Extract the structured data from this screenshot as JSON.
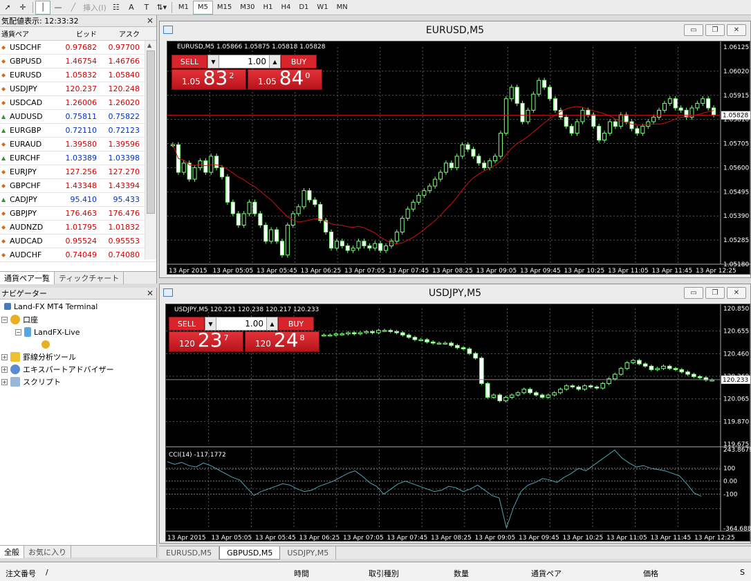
{
  "toolbar": {
    "insert_label": "挿入(I)",
    "timeframes": [
      "M1",
      "M5",
      "M15",
      "M30",
      "H1",
      "H4",
      "D1",
      "W1",
      "MN"
    ]
  },
  "market_watch": {
    "title": "気配値表示: 12:33:32",
    "col_symbol": "通貨ペア",
    "col_bid": "ビッド",
    "col_ask": "アスク",
    "rows": [
      {
        "symbol": "USDCHF",
        "bid": "0.97682",
        "ask": "0.97700",
        "color": "red",
        "dir": "down"
      },
      {
        "symbol": "GBPUSD",
        "bid": "1.46754",
        "ask": "1.46766",
        "color": "red",
        "dir": "down"
      },
      {
        "symbol": "EURUSD",
        "bid": "1.05832",
        "ask": "1.05840",
        "color": "red",
        "dir": "down"
      },
      {
        "symbol": "USDJPY",
        "bid": "120.237",
        "ask": "120.248",
        "color": "red",
        "dir": "down"
      },
      {
        "symbol": "USDCAD",
        "bid": "1.26006",
        "ask": "1.26020",
        "color": "red",
        "dir": "down"
      },
      {
        "symbol": "AUDUSD",
        "bid": "0.75811",
        "ask": "0.75822",
        "color": "blue",
        "dir": "up"
      },
      {
        "symbol": "EURGBP",
        "bid": "0.72110",
        "ask": "0.72123",
        "color": "blue",
        "dir": "up"
      },
      {
        "symbol": "EURAUD",
        "bid": "1.39580",
        "ask": "1.39596",
        "color": "red",
        "dir": "down"
      },
      {
        "symbol": "EURCHF",
        "bid": "1.03389",
        "ask": "1.03398",
        "color": "blue",
        "dir": "up"
      },
      {
        "symbol": "EURJPY",
        "bid": "127.256",
        "ask": "127.270",
        "color": "red",
        "dir": "down"
      },
      {
        "symbol": "GBPCHF",
        "bid": "1.43348",
        "ask": "1.43394",
        "color": "red",
        "dir": "down"
      },
      {
        "symbol": "CADJPY",
        "bid": "95.410",
        "ask": "95.433",
        "color": "blue",
        "dir": "up"
      },
      {
        "symbol": "GBPJPY",
        "bid": "176.463",
        "ask": "176.476",
        "color": "red",
        "dir": "down"
      },
      {
        "symbol": "AUDNZD",
        "bid": "1.01795",
        "ask": "1.01832",
        "color": "red",
        "dir": "down"
      },
      {
        "symbol": "AUDCAD",
        "bid": "0.95524",
        "ask": "0.95553",
        "color": "red",
        "dir": "down"
      },
      {
        "symbol": "AUDCHF",
        "bid": "0.74049",
        "ask": "0.74080",
        "color": "red",
        "dir": "down"
      }
    ],
    "tab_symbols": "通貨ペア一覧",
    "tab_tick": "ティックチャート"
  },
  "navigator": {
    "title": "ナビゲーター",
    "root": "Land-FX MT4 Terminal",
    "accounts": "口座",
    "account_live": "LandFX-Live",
    "indicators": "罫線分析ツール",
    "experts": "エキスパートアドバイザー",
    "scripts": "スクリプト",
    "tab_general": "全般",
    "tab_favorites": "お気に入り"
  },
  "chart_eurusd": {
    "window_title": "EURUSD,M5",
    "info_line": "EURUSD,M5  1.05866 1.05875 1.05818 1.05828",
    "sell_label": "SELL",
    "buy_label": "BUY",
    "lot": "1.00",
    "sell_prefix": "1.05",
    "sell_big": "83",
    "sell_sup": "2",
    "buy_prefix": "1.05",
    "buy_big": "84",
    "buy_sup": "0",
    "price_marker": "1.05828",
    "price_axis": [
      "1.06125",
      "1.06020",
      "1.05915",
      "1.05810",
      "1.05705",
      "1.05600",
      "1.05495",
      "1.05390",
      "1.05285",
      "1.05180"
    ],
    "time_axis": [
      "13 Apr 2015",
      "13 Apr 05:05",
      "13 Apr 05:45",
      "13 Apr 06:25",
      "13 Apr 07:05",
      "13 Apr 07:45",
      "13 Apr 08:25",
      "13 Apr 09:05",
      "13 Apr 09:45",
      "13 Apr 10:25",
      "13 Apr 11:05",
      "13 Apr 11:45",
      "13 Apr 12:25"
    ]
  },
  "chart_usdjpy": {
    "window_title": "USDJPY,M5",
    "info_line": "USDJPY,M5  120.221 120.238 120.217 120.233",
    "sell_label": "SELL",
    "buy_label": "BUY",
    "lot": "1.00",
    "sell_prefix": "120",
    "sell_big": "23",
    "sell_sup": "7",
    "buy_prefix": "120",
    "buy_big": "24",
    "buy_sup": "8",
    "price_marker": "120.233",
    "price_axis": [
      "120.850",
      "120.655",
      "120.460",
      "120.260",
      "120.065",
      "119.870",
      "119.675"
    ],
    "cci_label": "CCI(14) -117.1772",
    "cci_axis": [
      "243.8679",
      "100",
      "0.00",
      "-100",
      "-364.6885"
    ],
    "time_axis": [
      "13 Apr 2015",
      "13 Apr 05:05",
      "13 Apr 05:45",
      "13 Apr 06:25",
      "13 Apr 07:05",
      "13 Apr 07:45",
      "13 Apr 08:25",
      "13 Apr 09:05",
      "13 Apr 09:45",
      "13 Apr 10:25",
      "13 Apr 11:05",
      "13 Apr 11:45",
      "13 Apr 12:25"
    ]
  },
  "doc_tabs": [
    "EURUSD,M5",
    "GBPUSD,M5",
    "USDJPY,M5"
  ],
  "terminal": {
    "col_order": "注文番号",
    "col_time": "時間",
    "col_type": "取引種別",
    "col_qty": "数量",
    "col_symbol": "通貨ペア",
    "col_price": "価格",
    "col_s": "S"
  },
  "colors": {
    "bull": "#7dff7d",
    "bear": "#ffffff",
    "ma": "#d01010",
    "cci": "#4aa8b8",
    "grid": "#5a5a5a"
  },
  "chart_data": [
    {
      "type": "candlestick",
      "title": "EURUSD,M5",
      "closes": [
        1.057,
        1.0558,
        1.0562,
        1.0555,
        1.056,
        1.0563,
        1.0558,
        1.0565,
        1.056,
        1.0556,
        1.0545,
        1.054,
        1.0535,
        1.054,
        1.0545,
        1.054,
        1.0535,
        1.0528,
        1.0533,
        1.0528,
        1.0522,
        1.0535,
        1.054,
        1.0543,
        1.055,
        1.0546,
        1.0544,
        1.0537,
        1.0532,
        1.0525,
        1.0528,
        1.0526,
        1.0524,
        1.0525,
        1.0528,
        1.0526,
        1.0525,
        1.0527,
        1.0524,
        1.0526,
        1.0528,
        1.0532,
        1.0538,
        1.0542,
        1.0545,
        1.0548,
        1.055,
        1.0552,
        1.0555,
        1.0558,
        1.0562,
        1.056,
        1.0565,
        1.057,
        1.0568,
        1.0565,
        1.0562,
        1.056,
        1.0563,
        1.0565,
        1.0575,
        1.059,
        1.0595,
        1.0588,
        1.058,
        1.0585,
        1.0592,
        1.0598,
        1.0595,
        1.059,
        1.0585,
        1.0582,
        1.0578,
        1.0575,
        1.058,
        1.0585,
        1.0583,
        1.0578,
        1.0572,
        1.0575,
        1.058,
        1.0578,
        1.0583,
        1.058,
        1.0577,
        1.0575,
        1.0578,
        1.058,
        1.0582,
        1.0585,
        1.0588,
        1.059,
        1.0586,
        1.0585,
        1.0582,
        1.0586,
        1.0588,
        1.059,
        1.0586,
        1.0583
      ],
      "ylim": [
        1.0518,
        1.06125
      ]
    },
    {
      "type": "candlestick",
      "title": "USDJPY,M5",
      "closes": [
        120.62,
        120.62,
        120.63,
        120.63,
        120.64,
        120.63,
        120.64,
        120.65,
        120.64,
        120.66,
        120.66,
        120.65,
        120.64,
        120.62,
        120.6,
        120.58,
        120.58,
        120.56,
        120.55,
        120.55,
        120.55,
        120.53,
        120.51,
        120.5,
        120.46,
        120.42,
        120.2,
        120.08,
        120.1,
        120.05,
        120.08,
        120.1,
        120.12,
        120.15,
        120.12,
        120.1,
        120.08,
        120.1,
        120.12,
        120.15,
        120.18,
        120.17,
        120.15,
        120.18,
        120.17,
        120.16,
        120.2,
        120.24,
        120.28,
        120.33,
        120.38,
        120.4,
        120.37,
        120.35,
        120.32,
        120.33,
        120.35,
        120.33,
        120.32,
        120.3,
        120.28,
        120.26,
        120.25,
        120.23,
        120.23
      ],
      "ylim": [
        119.675,
        120.85
      ]
    },
    {
      "type": "line",
      "title": "CCI(14) -117.1772",
      "values": [
        150,
        130,
        145,
        120,
        110,
        140,
        120,
        90,
        60,
        30,
        10,
        -50,
        -110,
        -80,
        -60,
        -40,
        -20,
        -30,
        -60,
        -80,
        -70,
        -40,
        -20,
        0,
        30,
        60,
        80,
        40,
        -10,
        -40,
        -100,
        -60,
        -20,
        0,
        -20,
        -40,
        -60,
        -80,
        -70,
        -40,
        -50,
        -80,
        -60,
        -30,
        -70,
        -110,
        -130,
        -360,
        -200,
        -80,
        -30,
        -10,
        20,
        10,
        -10,
        30,
        60,
        100,
        80,
        120,
        160,
        200,
        240,
        180,
        140,
        110,
        120,
        100,
        90,
        80,
        60,
        40,
        -20,
        -90,
        -117
      ],
      "ylim": [
        -364.6885,
        243.8679
      ]
    }
  ]
}
